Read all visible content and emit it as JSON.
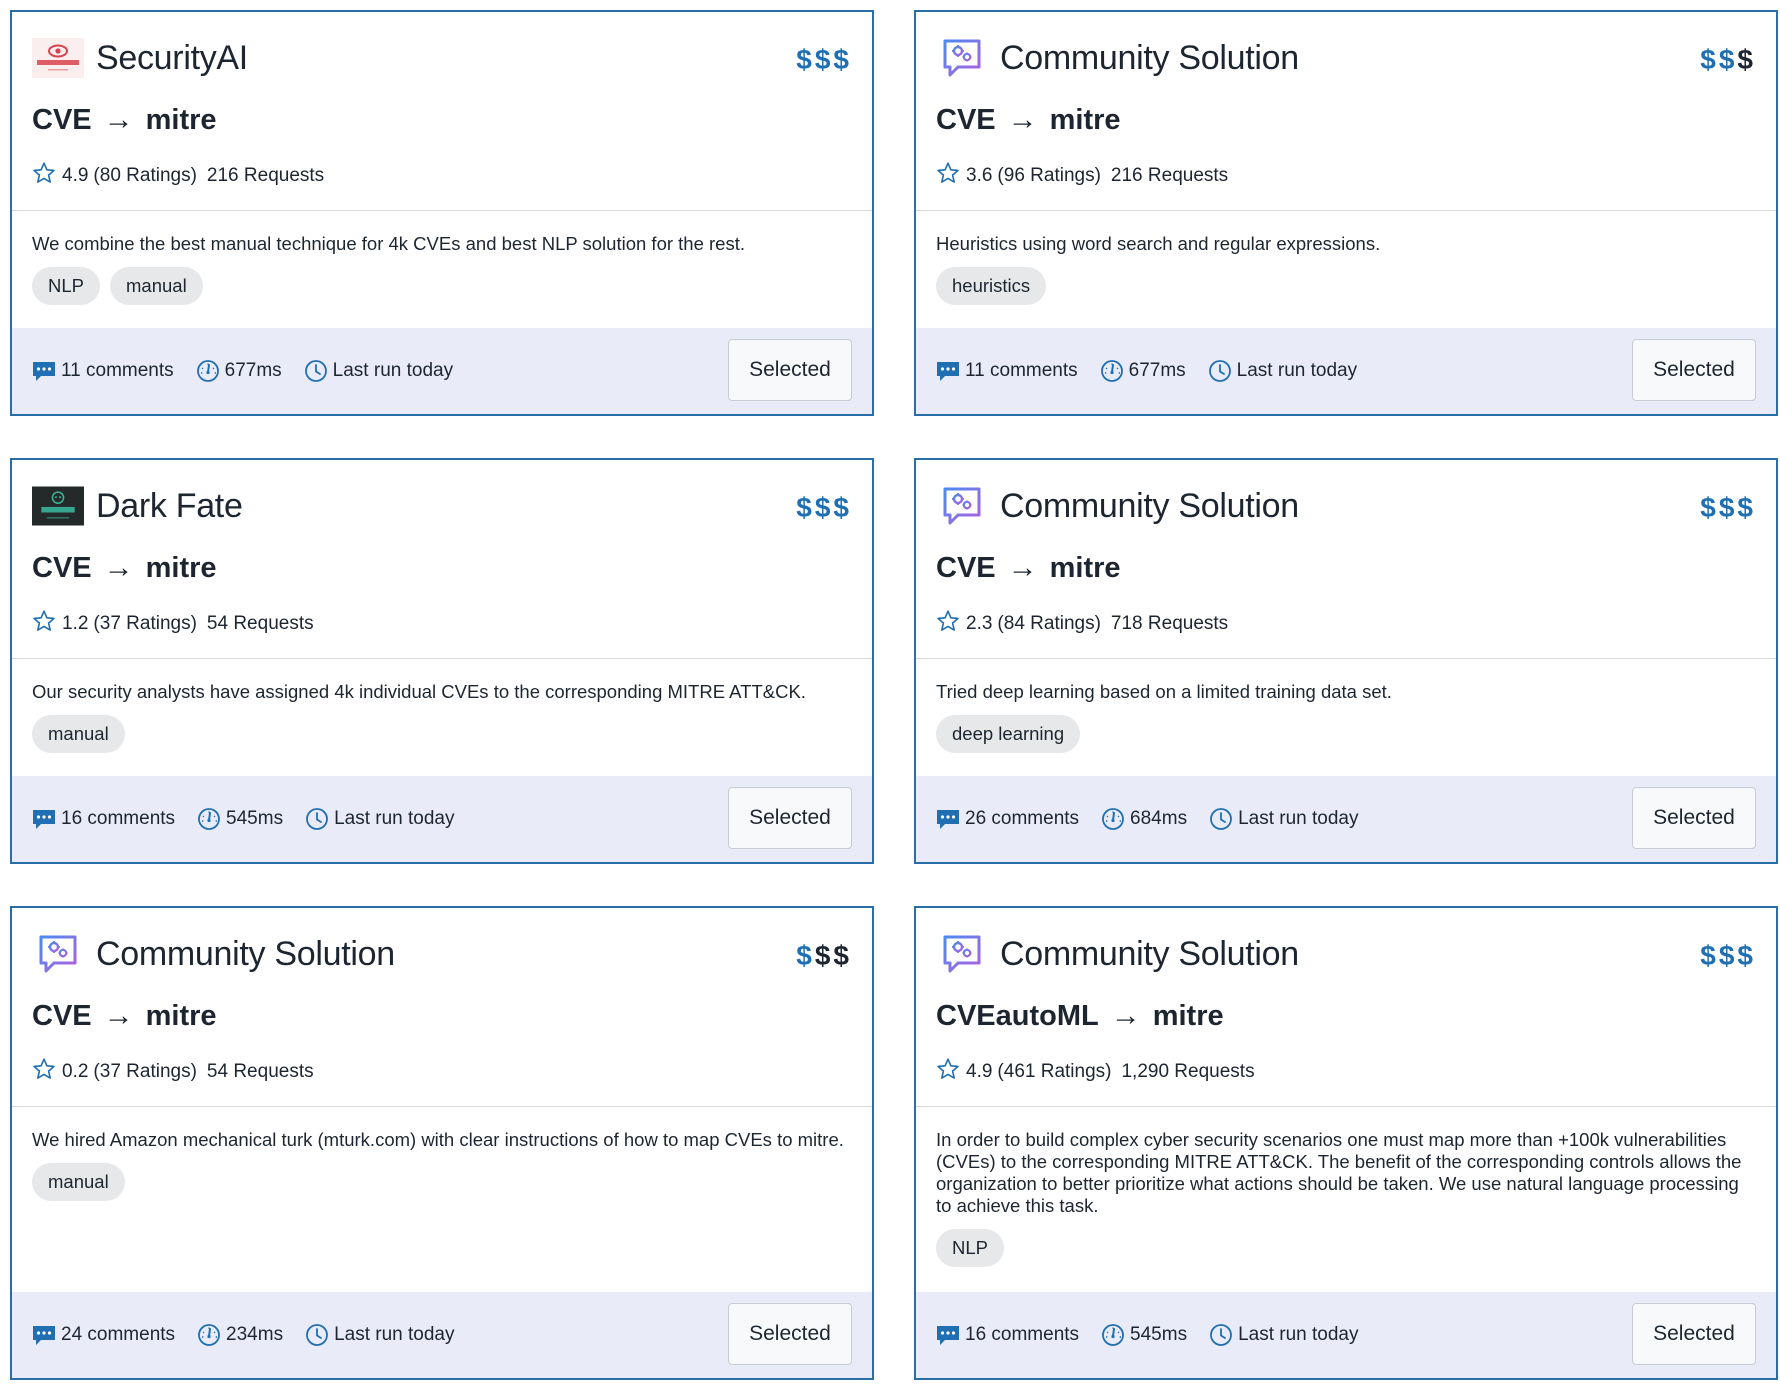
{
  "cards": [
    {
      "vendor": "SecurityAI",
      "logo": "securityai-logo",
      "price_active": 3,
      "source": "CVE",
      "target": "mitre",
      "rating": "4.9",
      "ratings_count": "(80 Ratings)",
      "requests": "216 Requests",
      "description": "We combine the best manual technique for 4k CVEs and best NLP solution for the rest.",
      "tags": [
        "NLP",
        "manual"
      ],
      "comments": "11 comments",
      "latency": "677ms",
      "last_run": "Last run today",
      "button": "Selected"
    },
    {
      "vendor": "Community Solution",
      "logo": "community-icon",
      "price_active": 2,
      "source": "CVE",
      "target": "mitre",
      "rating": "3.6",
      "ratings_count": "(96 Ratings)",
      "requests": "216 Requests",
      "description": "Heuristics using word search and regular expressions.",
      "tags": [
        "heuristics"
      ],
      "comments": "11 comments",
      "latency": "677ms",
      "last_run": "Last run today",
      "button": "Selected"
    },
    {
      "vendor": "Dark Fate",
      "logo": "darkfate-logo",
      "logo_text": "dark fate",
      "price_active": 3,
      "source": "CVE",
      "target": "mitre",
      "rating": "1.2",
      "ratings_count": "(37 Ratings)",
      "requests": "54 Requests",
      "description": "Our security analysts have assigned 4k individual CVEs to the corresponding MITRE ATT&CK.",
      "tags": [
        "manual"
      ],
      "comments": "16 comments",
      "latency": "545ms",
      "last_run": "Last run today",
      "button": "Selected"
    },
    {
      "vendor": "Community Solution",
      "logo": "community-icon",
      "price_active": 3,
      "source": "CVE",
      "target": "mitre",
      "rating": "2.3",
      "ratings_count": "(84 Ratings)",
      "requests": "718 Requests",
      "description": "Tried deep learning based on a limited training data set.",
      "tags": [
        "deep learning"
      ],
      "comments": "26 comments",
      "latency": "684ms",
      "last_run": "Last run today",
      "button": "Selected"
    },
    {
      "vendor": "Community Solution",
      "logo": "community-icon",
      "price_active": 1,
      "source": "CVE",
      "target": "mitre",
      "rating": "0.2",
      "ratings_count": "(37 Ratings)",
      "requests": "54 Requests",
      "description": "We hired Amazon mechanical turk (mturk.com) with clear instructions of how to map CVEs to mitre.",
      "tags": [
        "manual"
      ],
      "comments": "24 comments",
      "latency": "234ms",
      "last_run": "Last run today",
      "button": "Selected"
    },
    {
      "vendor": "Community Solution",
      "logo": "community-icon",
      "price_active": 3,
      "source": "CVEautoML",
      "target": "mitre",
      "rating": "4.9",
      "ratings_count": "(461 Ratings)",
      "requests": "1,290 Requests",
      "description": "In order to build complex cyber security scenarios one must map more than +100k vulnerabilities (CVEs) to the corresponding MITRE ATT&CK. The benefit of the corresponding controls allows the organization to better prioritize what actions should be taken. We use natural language processing to achieve this task.",
      "tags": [
        "NLP"
      ],
      "comments": "16 comments",
      "latency": "545ms",
      "last_run": "Last run today",
      "button": "Selected"
    }
  ],
  "price_symbol": "$",
  "arrow": "→",
  "colors": {
    "accent": "#1f6fb2",
    "border": "#2a6ea8",
    "footer_bg": "#e9ecf8",
    "tag_bg": "#e7e8ea"
  }
}
